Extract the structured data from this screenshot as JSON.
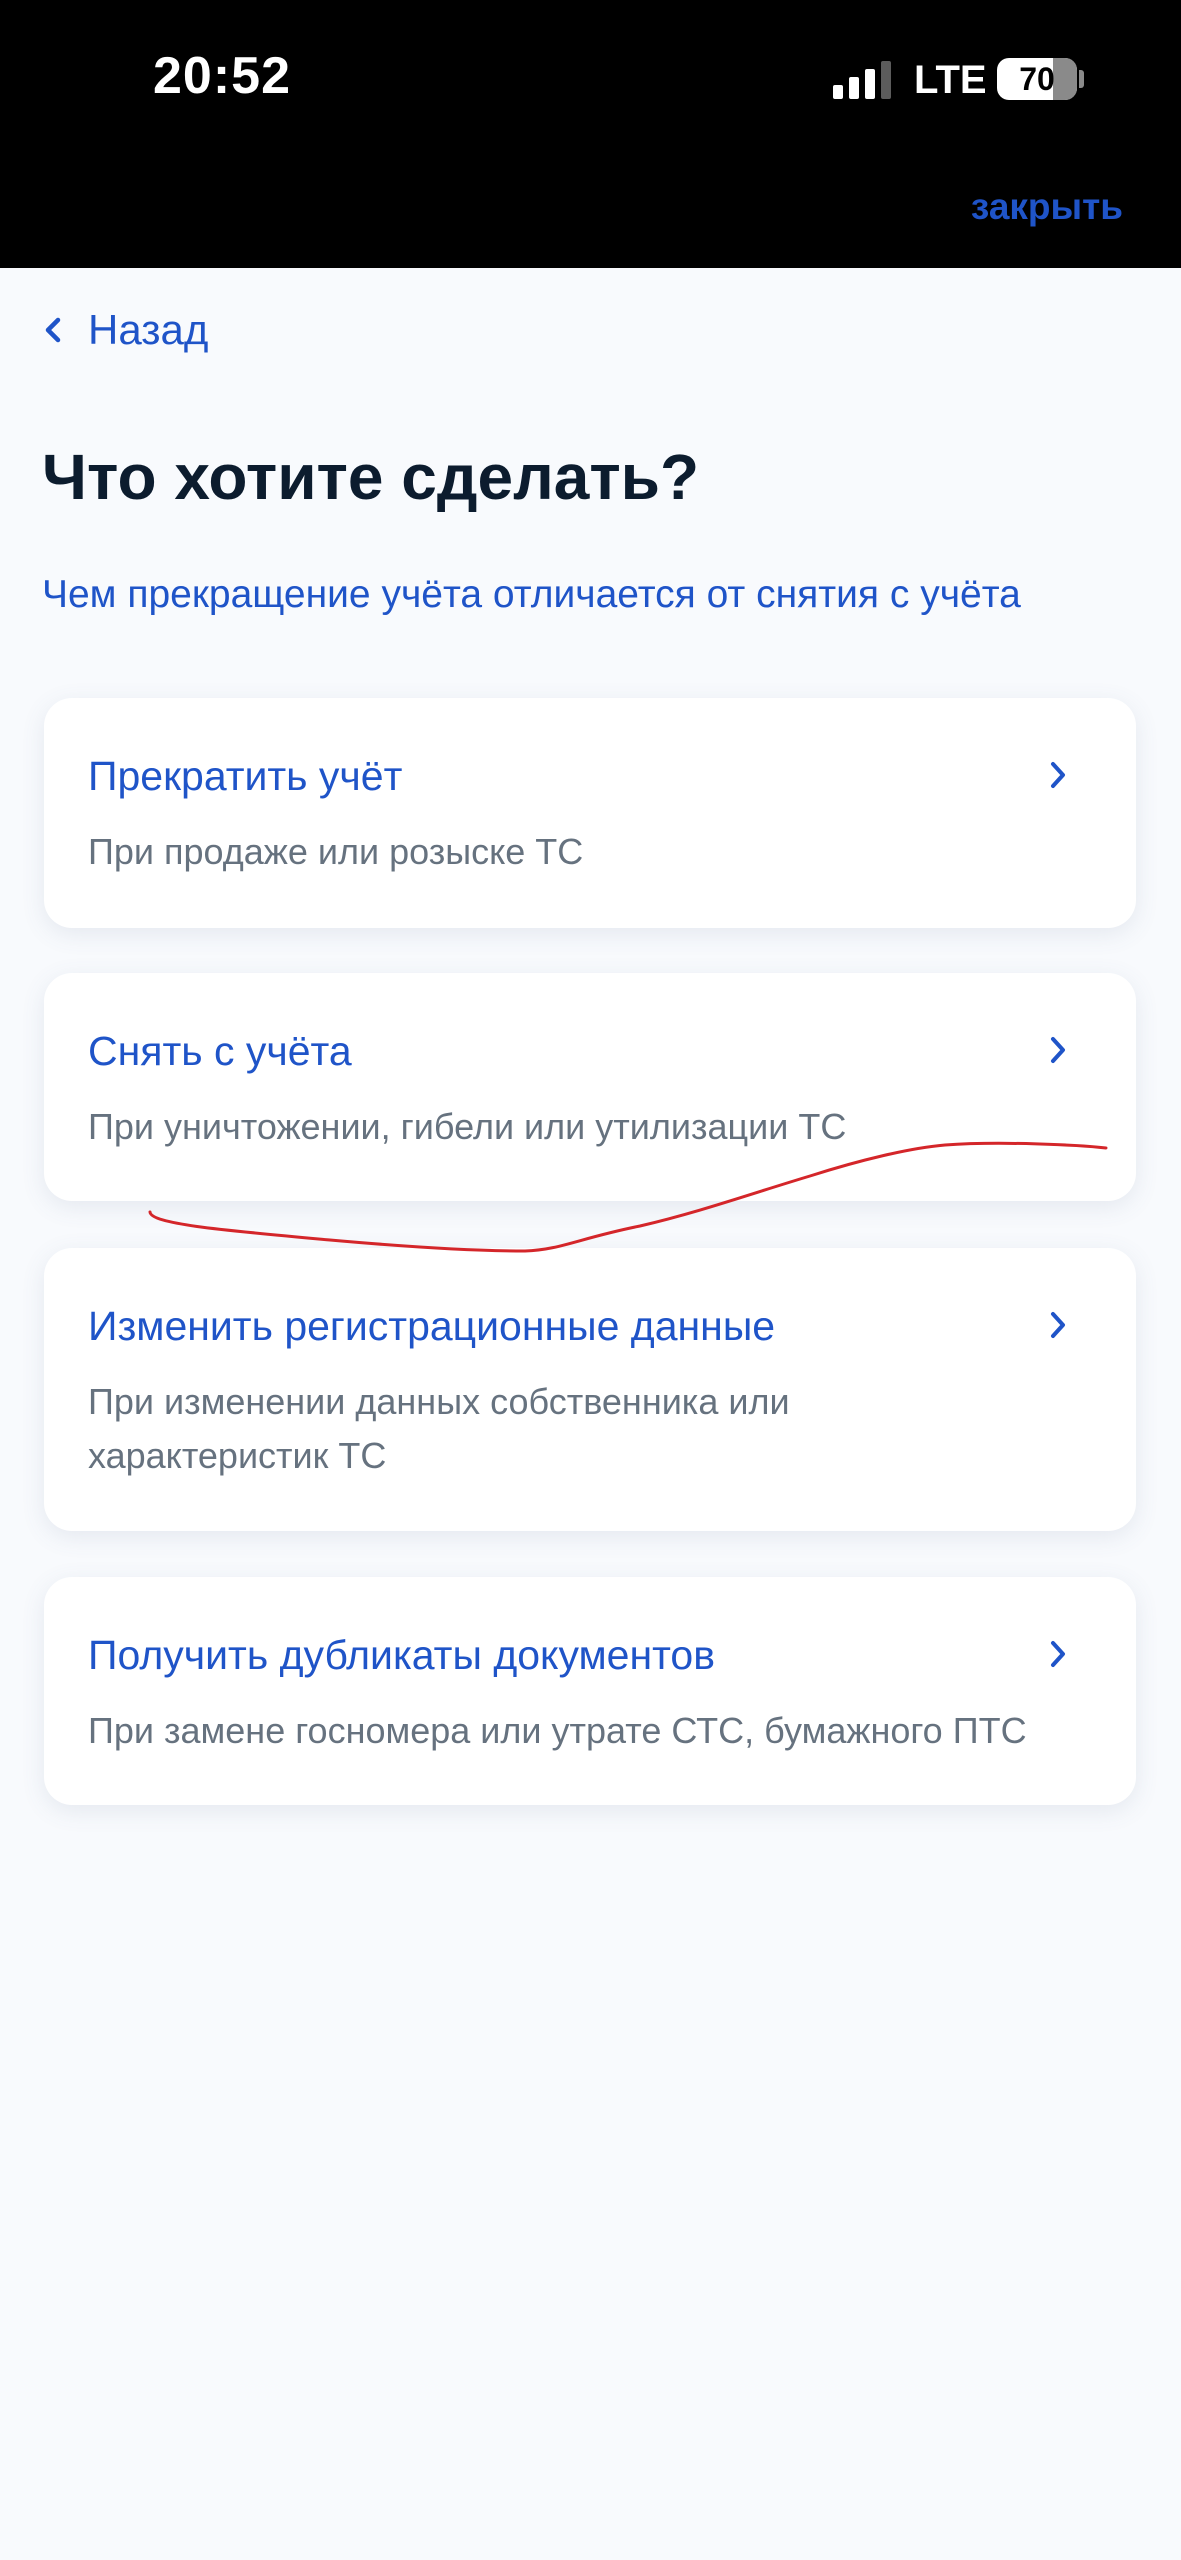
{
  "status_bar": {
    "time": "20:52",
    "network": "LTE",
    "battery_level": "70",
    "battery_fraction": 0.7
  },
  "header": {
    "close_label": "закрыть"
  },
  "navigation": {
    "back_label": "Назад"
  },
  "main": {
    "title": "Что хотите сделать?",
    "info_link": "Чем прекращение учёта отличается от снятия с учёта",
    "options": [
      {
        "title": "Прекратить учёт",
        "subtitle": "При продаже или розыске ТС"
      },
      {
        "title": "Снять с учёта",
        "subtitle": "При уничтожении, гибели или утилизации ТС"
      },
      {
        "title": "Изменить регистрационные данные",
        "subtitle": "При изменении данных собственника или характеристик ТС"
      },
      {
        "title": "Получить дубликаты документов",
        "subtitle": "При замене госномера или утрате СТС, бумажного ПТС"
      }
    ]
  },
  "icons": {
    "signal": "cellular-signal-icon",
    "battery": "battery-icon",
    "back": "chevron-left-icon",
    "option": "chevron-right-icon"
  },
  "colors": {
    "accent": "#1f54c8",
    "title": "#0c1c2e",
    "subtitle": "#66727f",
    "background": "#f8fafd",
    "annotation": "#d4262a"
  }
}
